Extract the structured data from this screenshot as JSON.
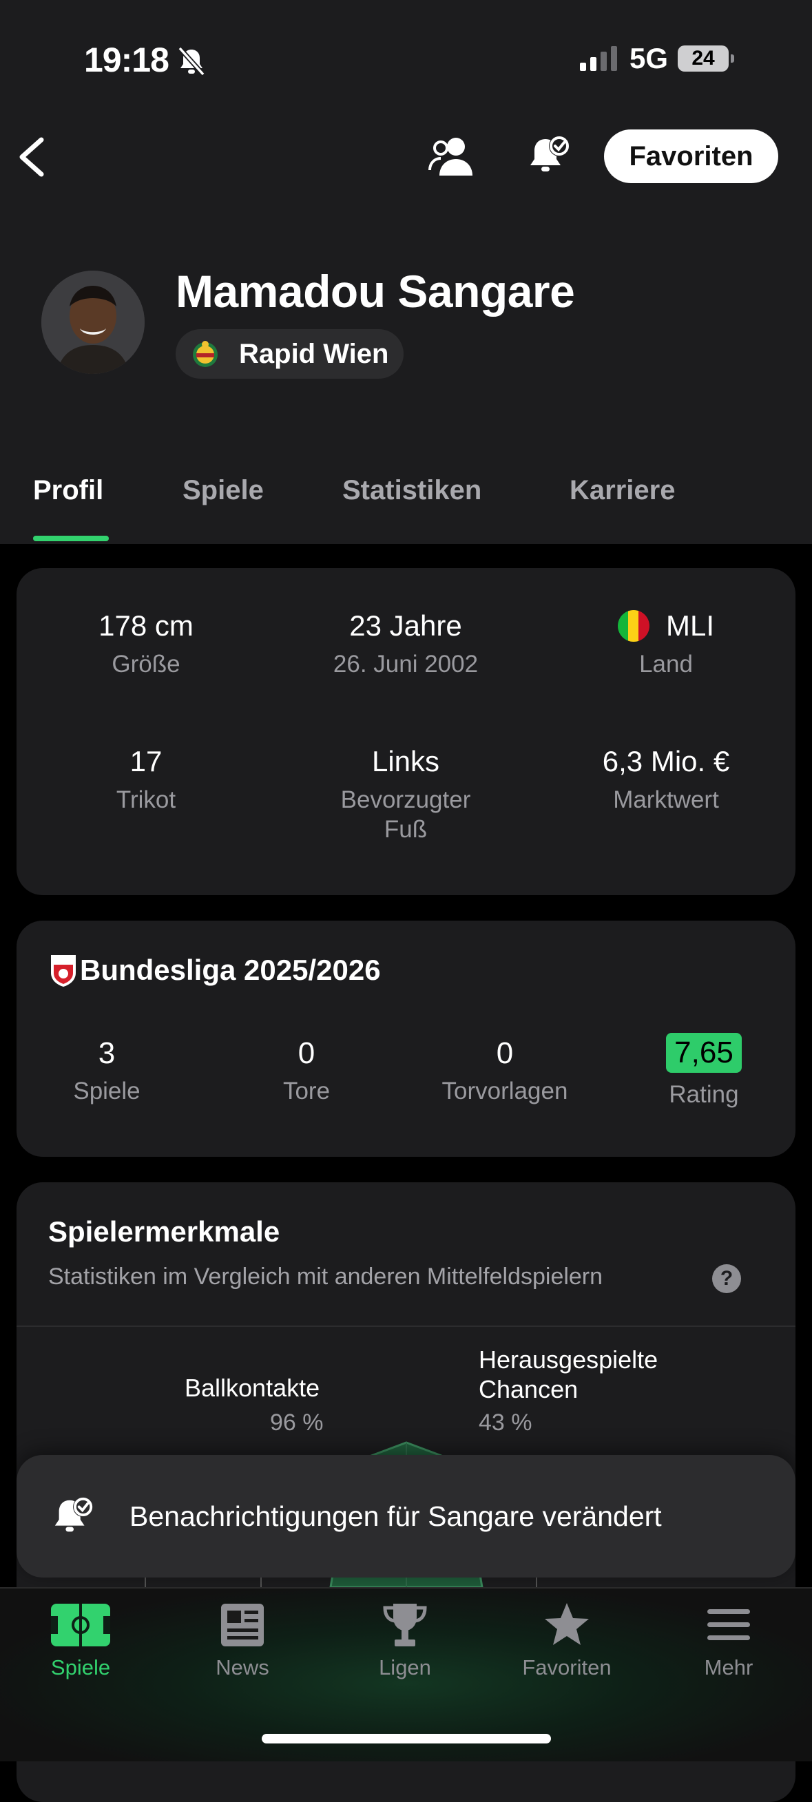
{
  "status_bar": {
    "time": "19:18",
    "network": "5G",
    "battery": "24"
  },
  "top_nav": {
    "favorite_button": "Favoriten"
  },
  "player": {
    "name": "Mamadou Sangare",
    "club": "Rapid Wien"
  },
  "tabs": [
    {
      "label": "Profil",
      "active": true
    },
    {
      "label": "Spiele"
    },
    {
      "label": "Statistiken"
    },
    {
      "label": "Karriere"
    }
  ],
  "profile_stats": {
    "height": {
      "value": "178 cm",
      "label": "Größe"
    },
    "age": {
      "value": "23 Jahre",
      "label": "26. Juni 2002"
    },
    "country": {
      "value": "MLI",
      "label": "Land"
    },
    "shirt": {
      "value": "17",
      "label": "Trikot"
    },
    "foot": {
      "value": "Links",
      "label": "Bevorzugter Fuß"
    },
    "market_value": {
      "value": "6,3 Mio. €",
      "label": "Marktwert"
    }
  },
  "season": {
    "title": "Bundesliga 2025/2026",
    "stats": [
      {
        "value": "3",
        "label": "Spiele"
      },
      {
        "value": "0",
        "label": "Tore"
      },
      {
        "value": "0",
        "label": "Torvorlagen"
      },
      {
        "value": "7,65",
        "label": "Rating"
      }
    ]
  },
  "attributes": {
    "title": "Spielermerkmale",
    "subtitle": "Statistiken im Vergleich mit anderen Mittelfeldspielern",
    "help": "?",
    "items": [
      {
        "label": "Ballkontakte",
        "value": "96 %"
      },
      {
        "label": "Herausgespielte Chancen",
        "value": "43 %"
      }
    ]
  },
  "toast": {
    "text": "Benachrichtigungen für Sangare verändert"
  },
  "bottom_nav": [
    {
      "label": "Spiele",
      "icon": "pitch-icon",
      "active": true
    },
    {
      "label": "News",
      "icon": "news-icon"
    },
    {
      "label": "Ligen",
      "icon": "trophy-icon"
    },
    {
      "label": "Favoriten",
      "icon": "star-icon"
    },
    {
      "label": "Mehr",
      "icon": "menu-icon"
    }
  ],
  "colors": {
    "accent": "#32d26e",
    "background": "#000000",
    "card": "#1c1c1e",
    "rating": "#2ecc6a"
  }
}
